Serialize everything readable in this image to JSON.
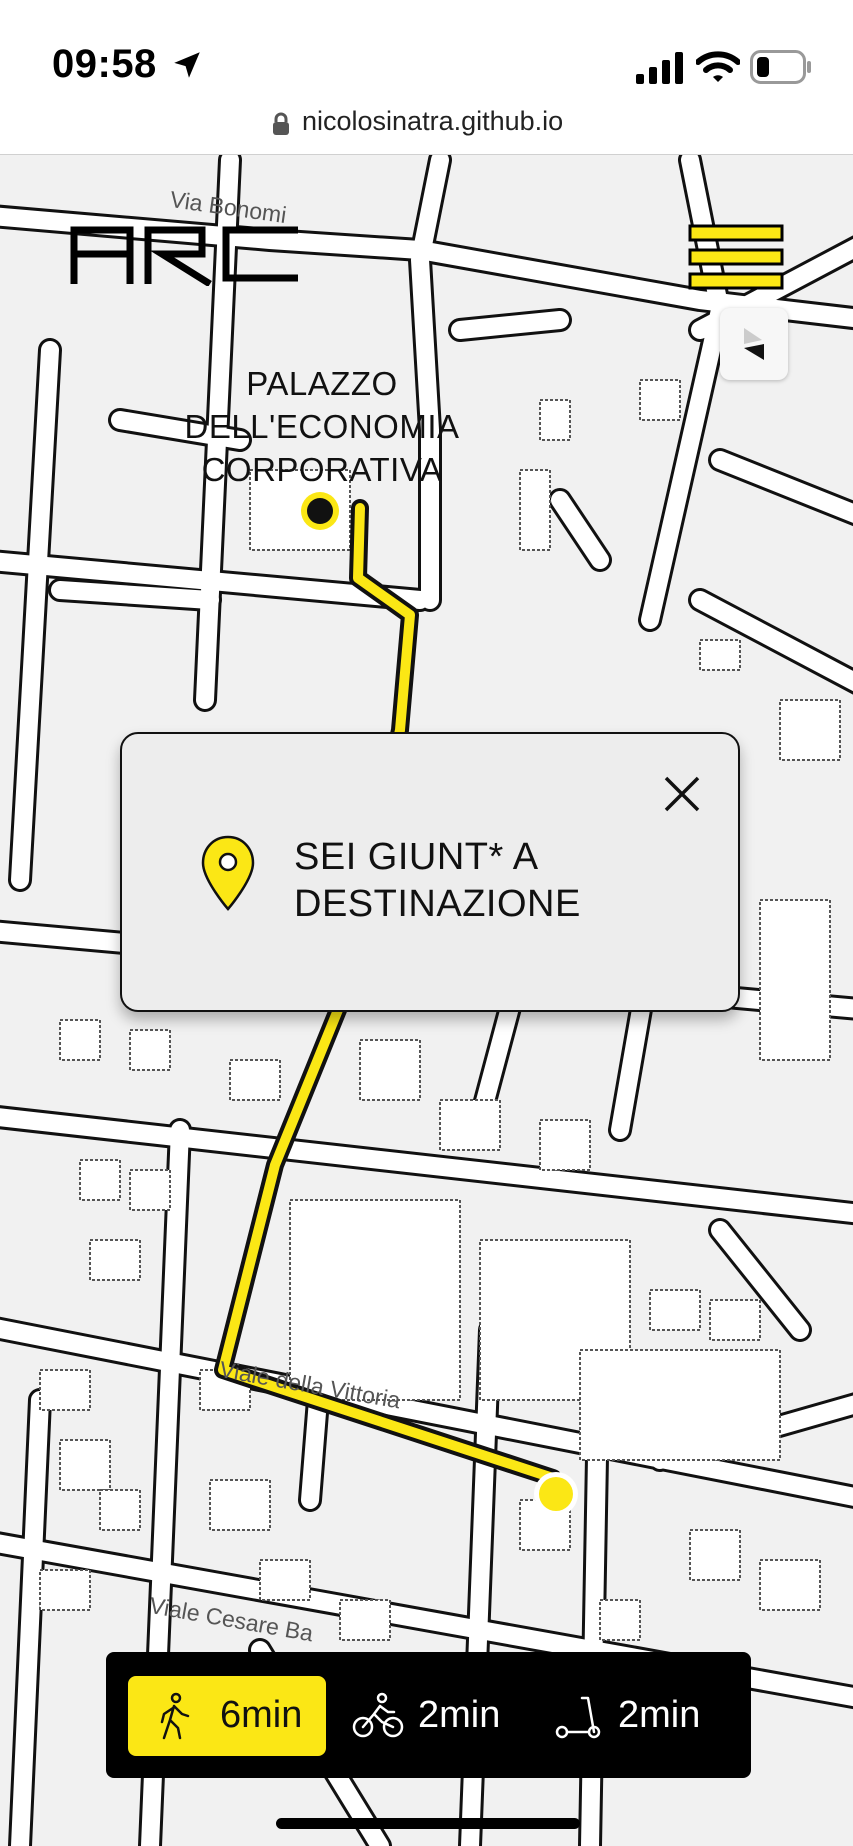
{
  "status": {
    "time": "09:58"
  },
  "browser": {
    "url": "nicolosinatra.github.io"
  },
  "app": {
    "logo_text": "ARC"
  },
  "map": {
    "place_label": [
      "PALAZZO",
      "DELL'ECONOMIA",
      "CORPORATIVA"
    ],
    "streets": {
      "bonomi": "Via Bonomi",
      "vittoria": "Viale della Vittoria",
      "cesare": "Viale Cesare Ba"
    }
  },
  "dialog": {
    "message": [
      "SEI GIUNT* A",
      "DESTINAZIONE"
    ]
  },
  "modes": [
    {
      "name": "walk",
      "label": "6min",
      "active": true
    },
    {
      "name": "bike",
      "label": "2min",
      "active": false
    },
    {
      "name": "scooter",
      "label": "2min",
      "active": false
    }
  ],
  "colors": {
    "accent": "#fbe715",
    "ink": "#000000",
    "map_bg": "#f1f1f1"
  }
}
